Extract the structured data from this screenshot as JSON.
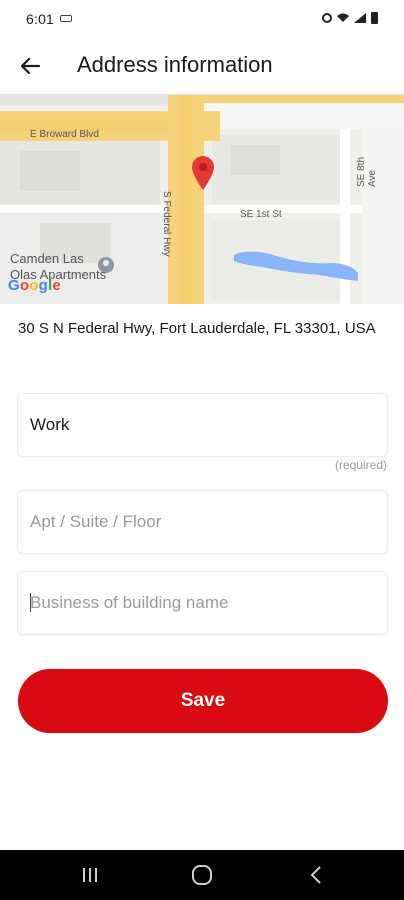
{
  "status_bar": {
    "time": "6:01",
    "icons": [
      "voicemail-icon",
      "alarm-icon",
      "wifi-icon",
      "signal-icon",
      "battery-icon"
    ]
  },
  "app_bar": {
    "back_icon": "arrow-left-icon",
    "title": "Address information"
  },
  "map": {
    "labels": {
      "broward": "E Broward Blvd",
      "se_1st": "SE 1st St",
      "federal": "S Federal Hwy",
      "se_8th": "SE 8th Ave",
      "camden": "Camden Las Olas Apartments",
      "camden_line1": "Camden Las",
      "camden_line2": "Olas Apartments"
    },
    "google_logo": "Google",
    "colors": {
      "road_major": "#f6d37a",
      "water": "#8ab4f8",
      "pin": "#e53935"
    }
  },
  "address": {
    "full": "30 S N Federal Hwy, Fort Lauderdale, FL 33301, USA"
  },
  "form": {
    "name_field": {
      "value": "Work",
      "placeholder": ""
    },
    "required_note": "(required)",
    "apt_field": {
      "value": "",
      "placeholder": "Apt / Suite / Floor"
    },
    "business_field": {
      "value": "",
      "placeholder": "Business of building name"
    }
  },
  "actions": {
    "save_label": "Save",
    "accent": "#d90a12"
  },
  "nav_bar": {
    "buttons": [
      "recent-apps-icon",
      "home-icon",
      "back-icon"
    ]
  }
}
